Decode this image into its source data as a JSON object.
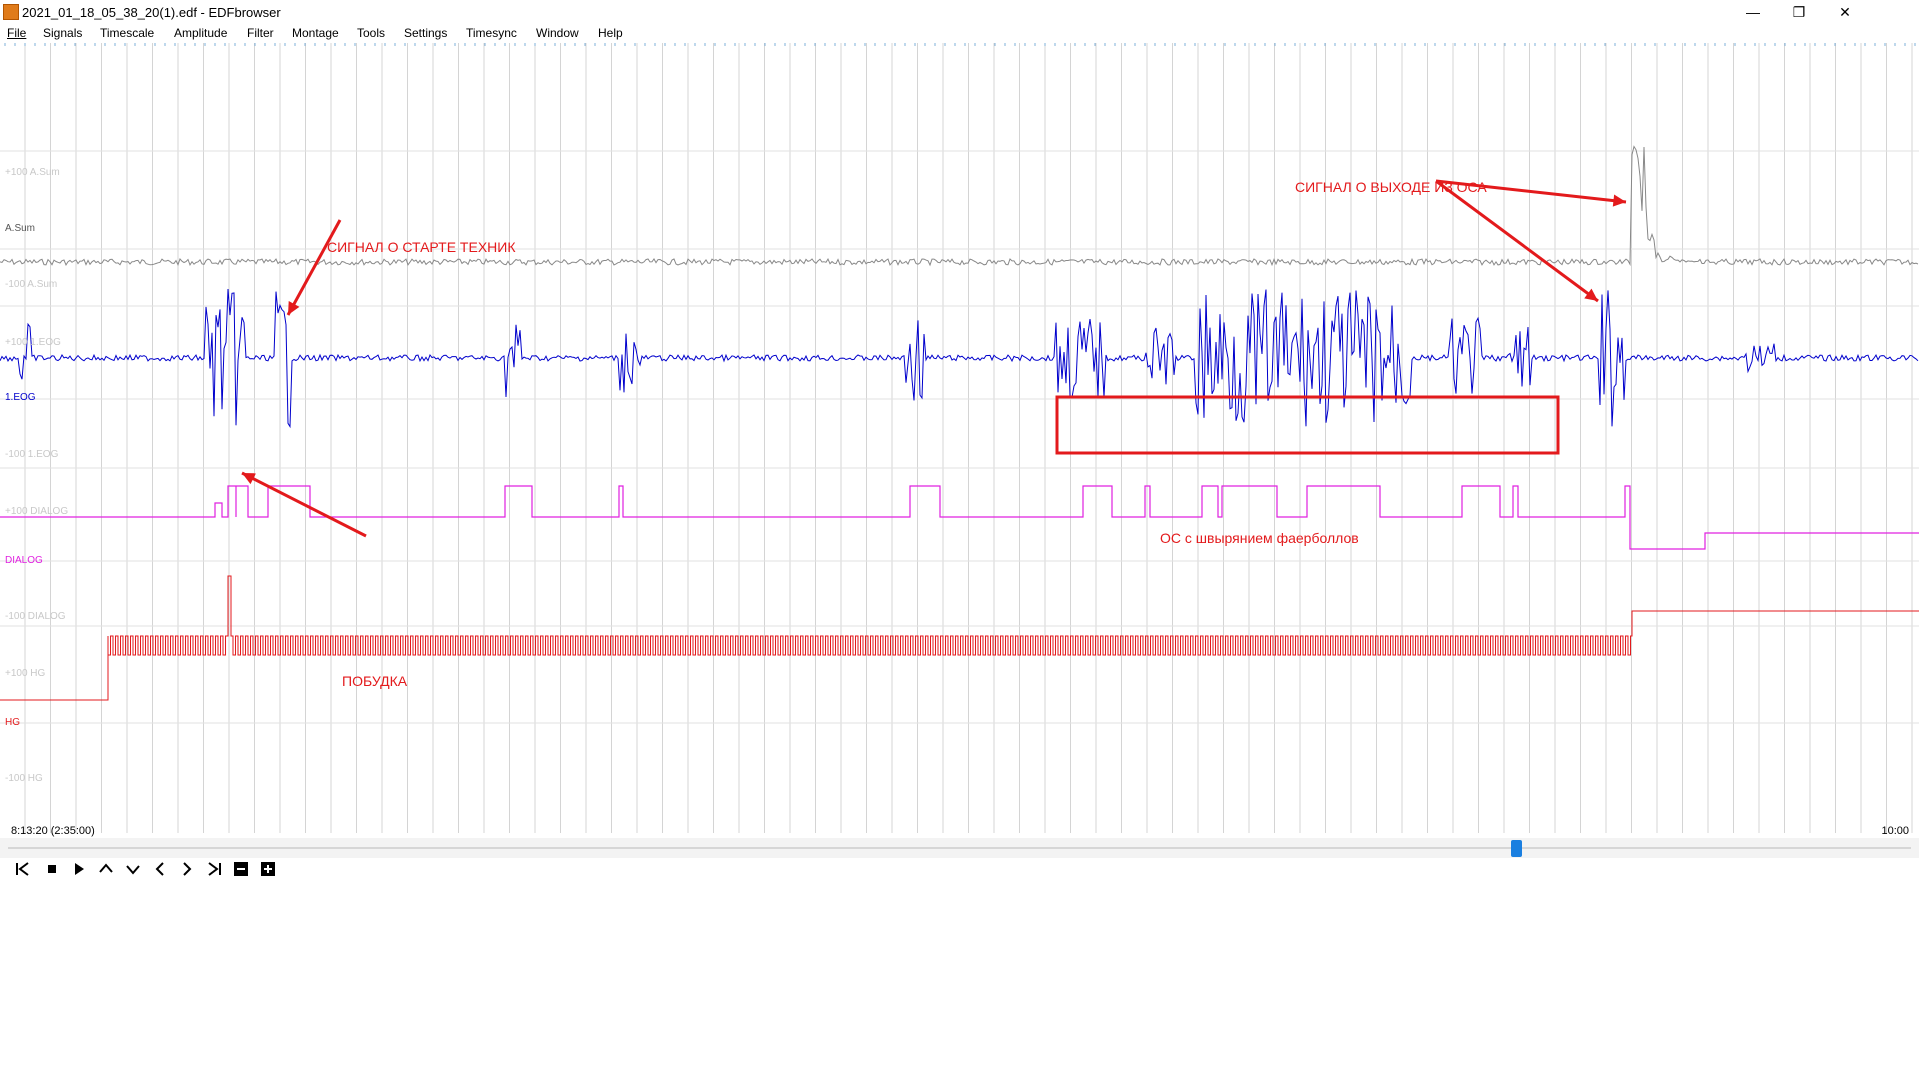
{
  "window": {
    "title": "2021_01_18_05_38_20(1).edf - EDFbrowser",
    "minimize": "—",
    "maximize": "❐",
    "close": "✕"
  },
  "menu": [
    "File",
    "Signals",
    "Timescale",
    "Amplitude",
    "Filter",
    "Montage",
    "Tools",
    "Settings",
    "Timesync",
    "Window",
    "Help"
  ],
  "channels": [
    {
      "name": "A.Sum",
      "upper": "+100 A.Sum",
      "lower": "-100 A.Sum",
      "color": "#888888"
    },
    {
      "name": "1.EOG",
      "upper": "+100 1.EOG",
      "lower": "-100 1.EOG",
      "color": "#0000cc"
    },
    {
      "name": "DIALOG",
      "upper": "+100 DIALOG",
      "lower": "-100 DIALOG",
      "color": "#e020e0"
    },
    {
      "name": "HG",
      "upper": "+100 HG",
      "lower": "-100 HG",
      "color": "#e31a1c"
    }
  ],
  "annotations": {
    "start_signal": "СИГНАЛ О СТАРТЕ ТЕХНИК",
    "exit_signal": "СИГНАЛ О ВЫХОДЕ ИЗ ОСА",
    "wakeup": "ПОБУДКА",
    "box_text": "ОС  с швырянием фаерболлов"
  },
  "timeline": {
    "start": "8:13:20 (2:35:00)",
    "end": "10:00"
  },
  "toolbar": {
    "icons": [
      "go-to-start-icon",
      "stop-icon",
      "play-icon",
      "amplitude-up-icon",
      "amplitude-down-icon",
      "page-back-icon",
      "page-forward-icon",
      "go-to-end-icon",
      "zoom-out-icon",
      "zoom-in-icon"
    ]
  }
}
